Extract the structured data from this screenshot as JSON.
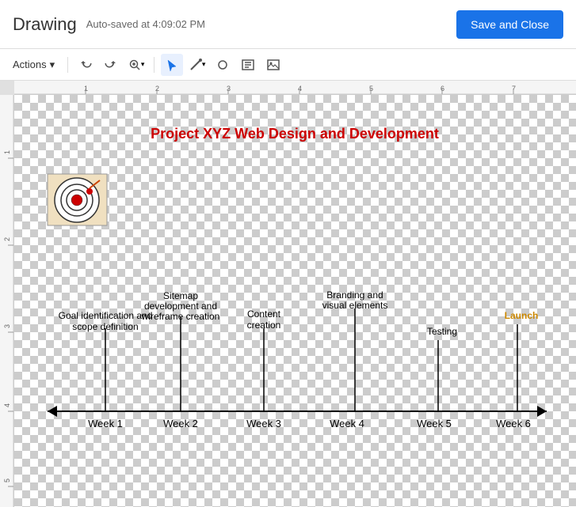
{
  "header": {
    "title": "Drawing",
    "autosave": "Auto-saved at 4:09:02 PM",
    "save_close_label": "Save and Close"
  },
  "toolbar": {
    "actions_label": "Actions",
    "actions_arrow": "▾",
    "undo_title": "Undo",
    "redo_title": "Redo",
    "zoom_title": "Zoom",
    "select_title": "Select",
    "line_title": "Line",
    "shapes_title": "Shapes",
    "text_title": "Text",
    "image_title": "Image"
  },
  "ruler": {
    "ticks": [
      "1",
      "2",
      "3",
      "4",
      "5",
      "6",
      "7"
    ]
  },
  "drawing": {
    "project_title": "Project XYZ Web Design and Development",
    "timeline": {
      "weeks": [
        "Week 1",
        "Week 2",
        "Week 3",
        "Week 4",
        "Week 5",
        "Week 6"
      ],
      "tasks": [
        {
          "label": "Goal identification and\nscope definition",
          "week_index": 0
        },
        {
          "label": "Sitemap\ndevelopment and\nwireframe creation",
          "week_index": 1
        },
        {
          "label": "Content\ncreation",
          "week_index": 2
        },
        {
          "label": "Branding and\nvisual elements",
          "week_index": 3
        },
        {
          "label": "Testing",
          "week_index": 4
        },
        {
          "label": "Launch",
          "week_index": 5,
          "color": "#cc8800"
        }
      ]
    }
  }
}
